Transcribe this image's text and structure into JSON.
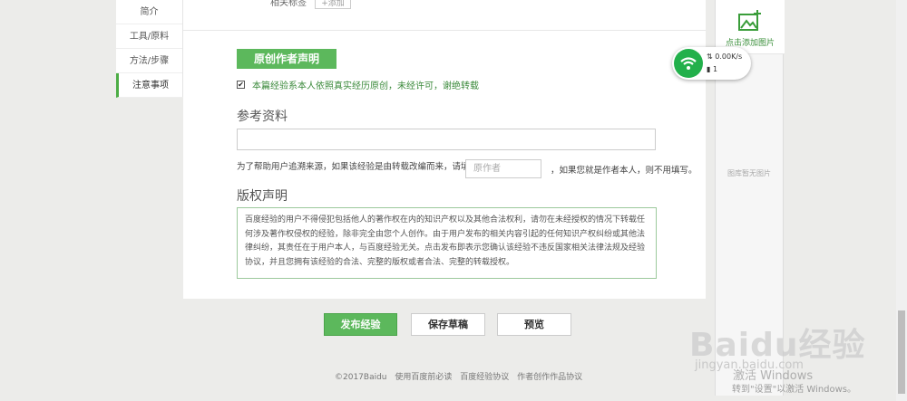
{
  "leftnav": {
    "items": [
      {
        "label": "简介"
      },
      {
        "label": "工具/原料"
      },
      {
        "label": "方法/步骤"
      },
      {
        "label": "注意事项"
      }
    ]
  },
  "tags": {
    "label": "相关标签",
    "add_label": "+添加"
  },
  "author": {
    "button_label": "原创作者声明",
    "declaration": "本篇经验系本人依照真实经历原创，未经许可，谢绝转载",
    "checked": "✔"
  },
  "reference": {
    "title": "参考资料",
    "source_prompt": "为了帮助用户追溯来源，如果该经验是由转载改编而来，请填写",
    "source_placeholder": "原作者",
    "source_hint": "，如果您就是作者本人，则不用填写。"
  },
  "copyright": {
    "title": "版权声明",
    "text": "百度经验的用户不得侵犯包括他人的著作权在内的知识产权以及其他合法权利，请勿在未经授权的情况下转载任何涉及著作权侵权的经验，除非完全由您个人创作。由于用户发布的相关内容引起的任何知识产权纠纷或其他法律纠纷，其责任在于用户本人，与百度经验无关。点击发布即表示您确认该经验不违反国家相关法律法规及经验协议，并且您拥有该经验的合法、完整的版权或者合法、完整的转载授权。"
  },
  "actions": {
    "publish": "发布经验",
    "draft": "保存草稿",
    "preview": "预览"
  },
  "right_panel": {
    "add_image": "点击添加图片",
    "no_image": "图库暂无图片"
  },
  "wifi": {
    "speed": "0.00K/s",
    "devices": "1"
  },
  "footer": {
    "copyright": "©2017Baidu",
    "links": [
      "使用百度前必读",
      "百度经验协议",
      "作者创作作品协议"
    ]
  },
  "watermark": {
    "brand": "Baidu经验",
    "domain": "jingyan.baidu.com"
  },
  "windows": {
    "line1": "激活 Windows",
    "line2": "转到\"设置\"以激活 Windows。"
  },
  "colors": {
    "accent": "#5cb85c",
    "wifi": "#22b04b"
  }
}
